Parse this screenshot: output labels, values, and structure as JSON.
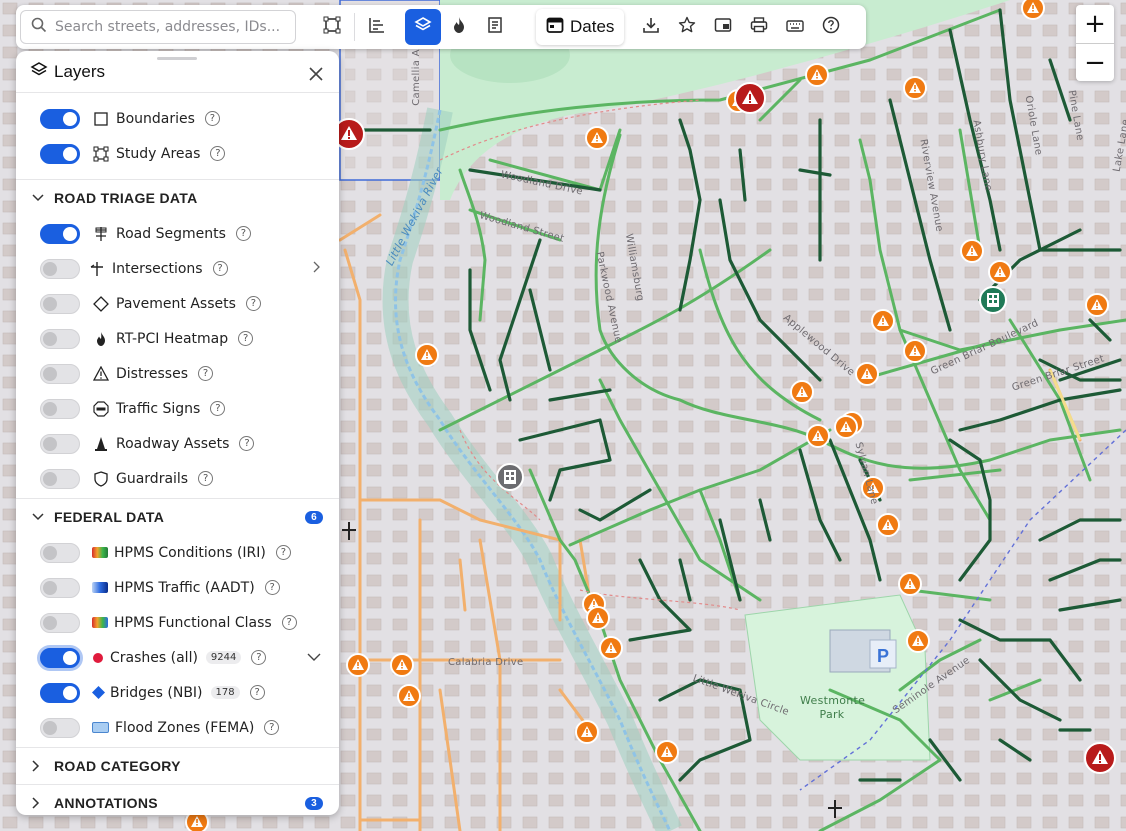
{
  "toolbar": {
    "search_placeholder": "Search streets, addresses, IDs...",
    "dates_label": "Dates",
    "accent_color": "#1a5fe0"
  },
  "zoom": {
    "in_label": "+",
    "out_label": "−"
  },
  "layers_panel": {
    "title": "Layers",
    "base_layers": [
      {
        "label": "Boundaries",
        "enabled": true,
        "icon": "square-icon"
      },
      {
        "label": "Study Areas",
        "enabled": true,
        "icon": "study-area-icon"
      }
    ],
    "sections": [
      {
        "title": "ROAD TRIAGE DATA",
        "expanded": true,
        "items": [
          {
            "label": "Road Segments",
            "enabled": true,
            "icon": "road-segments-icon"
          },
          {
            "label": "Intersections",
            "enabled": false,
            "icon": "intersection-icon",
            "has_submenu": true
          },
          {
            "label": "Pavement Assets",
            "enabled": false,
            "icon": "diamond-icon"
          },
          {
            "label": "RT-PCI Heatmap",
            "enabled": false,
            "icon": "flame-icon"
          },
          {
            "label": "Distresses",
            "enabled": false,
            "icon": "warning-triangle-icon"
          },
          {
            "label": "Traffic Signs",
            "enabled": false,
            "icon": "stop-sign-icon"
          },
          {
            "label": "Roadway Assets",
            "enabled": false,
            "icon": "traffic-cone-icon"
          },
          {
            "label": "Guardrails",
            "enabled": false,
            "icon": "shield-icon"
          }
        ]
      },
      {
        "title": "FEDERAL DATA",
        "expanded": true,
        "badge": "6",
        "items": [
          {
            "label": "HPMS Conditions (IRI)",
            "enabled": false,
            "icon": "gradient-swatch-icon"
          },
          {
            "label": "HPMS Traffic (AADT)",
            "enabled": false,
            "icon": "blue-gradient-swatch-icon"
          },
          {
            "label": "HPMS Functional Class",
            "enabled": false,
            "icon": "gradient-swatch-icon"
          },
          {
            "label": "Crashes (all)",
            "enabled": true,
            "icon": "red-dot-icon",
            "count": "9244",
            "has_dropdown": true
          },
          {
            "label": "Bridges (NBI)",
            "enabled": true,
            "icon": "blue-diamond-icon",
            "count": "178"
          },
          {
            "label": "Flood Zones (FEMA)",
            "enabled": false,
            "icon": "flood-swatch-icon"
          }
        ]
      },
      {
        "title": "ROAD CATEGORY",
        "expanded": false
      },
      {
        "title": "ANNOTATIONS",
        "expanded": false,
        "badge": "3"
      }
    ]
  },
  "map_labels": {
    "streets": [
      "Camellia A",
      "Little Wekiva River",
      "Woodland Drive",
      "Woodland Street",
      "Parkwood Avenue",
      "Williamsburg",
      "Applewood Drive",
      "Riverview Avenue",
      "Ashbury Lane",
      "Oriole Lane",
      "Pine Lane",
      "Lake Lane",
      "Green Briar Boulevard",
      "Green Briar Street",
      "Sylvan Lane",
      "Calabria Drive",
      "Seminole Avenue",
      "Little Wekiva Circle"
    ],
    "park": "Westmonte Park",
    "parking": "P"
  },
  "map_colors": {
    "road_good": "#5bb562",
    "road_excellent": "#1d5a36",
    "road_fair": "#f2b06d",
    "crash_marker": "#f07a12",
    "bridge_marker": "#b81b1b",
    "water": "#9bc9e8",
    "park": "#c8ecd0"
  }
}
